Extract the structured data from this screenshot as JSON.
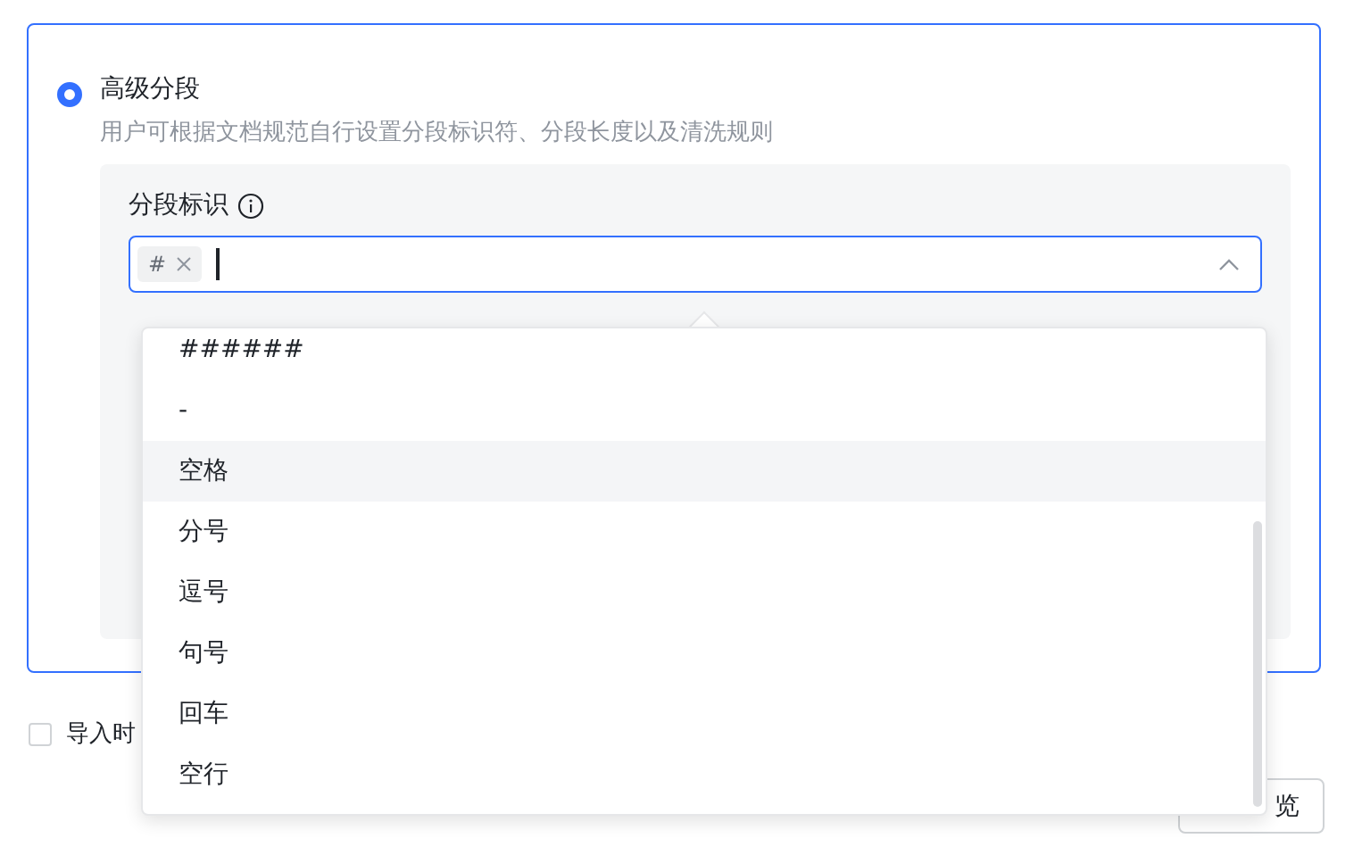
{
  "option": {
    "selected": true,
    "title": "高级分段",
    "description": "用户可根据文档规范自行设置分段标识符、分段长度以及清洗规则"
  },
  "separator_field": {
    "label": "分段标识",
    "tags": [
      "#"
    ],
    "expanded": true
  },
  "dropdown": {
    "items": [
      {
        "label": "######",
        "hovered": false
      },
      {
        "label": "-",
        "hovered": false
      },
      {
        "label": "空格",
        "hovered": true
      },
      {
        "label": "分号",
        "hovered": false
      },
      {
        "label": "逗号",
        "hovered": false
      },
      {
        "label": "句号",
        "hovered": false
      },
      {
        "label": "回车",
        "hovered": false
      },
      {
        "label": "空行",
        "hovered": false
      }
    ]
  },
  "import_checkbox": {
    "label": "导入时",
    "checked": false
  },
  "preview_button": {
    "label": "览"
  }
}
